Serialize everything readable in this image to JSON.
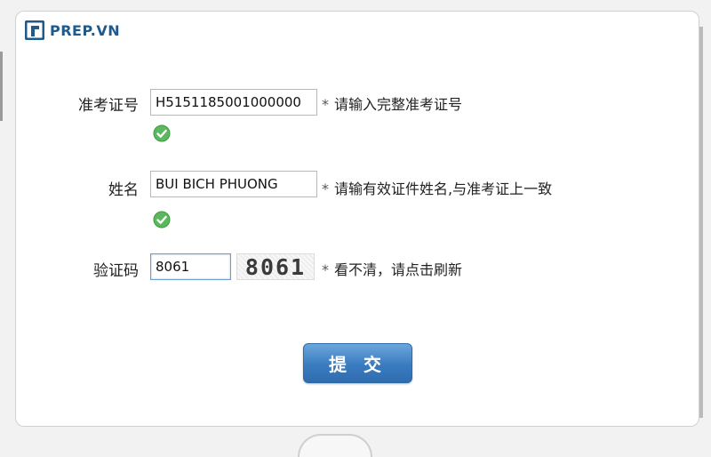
{
  "brand": {
    "name": "PREP.VN"
  },
  "form": {
    "exam_id": {
      "label": "准考证号",
      "value": "H5151185001000000",
      "hint": "请输入完整准考证号",
      "required_mark": "*"
    },
    "name": {
      "label": "姓名",
      "value": "BUI BICH PHUONG",
      "hint": "请输有效证件姓名,与准考证上一致",
      "required_mark": "*"
    },
    "captcha": {
      "label": "验证码",
      "value": "8061",
      "image_text": "8061",
      "hint": "看不清，请点击刷新",
      "required_mark": "*"
    },
    "submit_label": "提 交"
  },
  "colors": {
    "brand": "#1e5a8c",
    "button": "#3a7bc0",
    "success": "#4caf50"
  },
  "icons": {
    "valid": "check-circle-icon",
    "logo": "prep-logo-icon"
  }
}
